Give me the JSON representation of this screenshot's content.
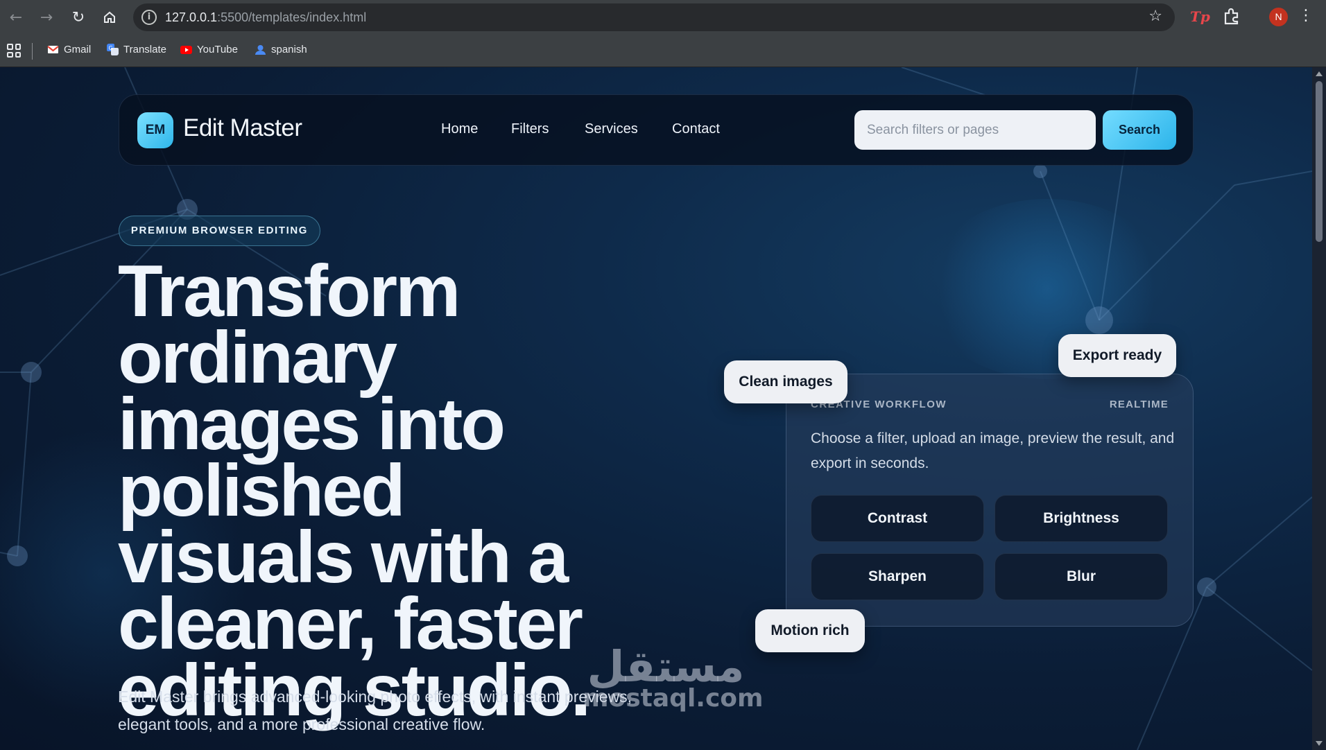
{
  "browser": {
    "url_host": "127.0.0.1",
    "url_rest": ":5500/templates/index.html",
    "bookmarks": [
      {
        "label": "Gmail",
        "icon": "gmail-icon"
      },
      {
        "label": "Translate",
        "icon": "translate-icon"
      },
      {
        "label": "YouTube",
        "icon": "youtube-icon"
      },
      {
        "label": "spanish",
        "icon": "folder-icon"
      }
    ],
    "profile_initial": "N",
    "extension_label": "Tp"
  },
  "header": {
    "logo_text": "EM",
    "brand": "Edit Master",
    "nav": [
      "Home",
      "Filters",
      "Services",
      "Contact"
    ],
    "search_placeholder": "Search filters or pages",
    "search_button": "Search"
  },
  "hero": {
    "badge": "PREMIUM BROWSER EDITING",
    "title": "Transform ordinary images into polished visuals with a cleaner, faster editing studio.",
    "subtitle": "Edit Master brings advanced-looking photo effects, with instant previews, elegant tools, and a more professional creative flow."
  },
  "workflow_card": {
    "kicker": "CREATIVE WORKFLOW",
    "tag": "REALTIME",
    "description": "Choose a filter, upload an image, preview the result, and export in seconds.",
    "filters": [
      "Contrast",
      "Brightness",
      "Sharpen",
      "Blur"
    ]
  },
  "chips": {
    "export": "Export ready",
    "clean": "Clean images",
    "motion": "Motion rich"
  },
  "watermark": {
    "arabic": "مستقل",
    "latin": "mostaql.com"
  },
  "colors": {
    "accent": "#3cc4f0",
    "background": "#0b1d36"
  }
}
